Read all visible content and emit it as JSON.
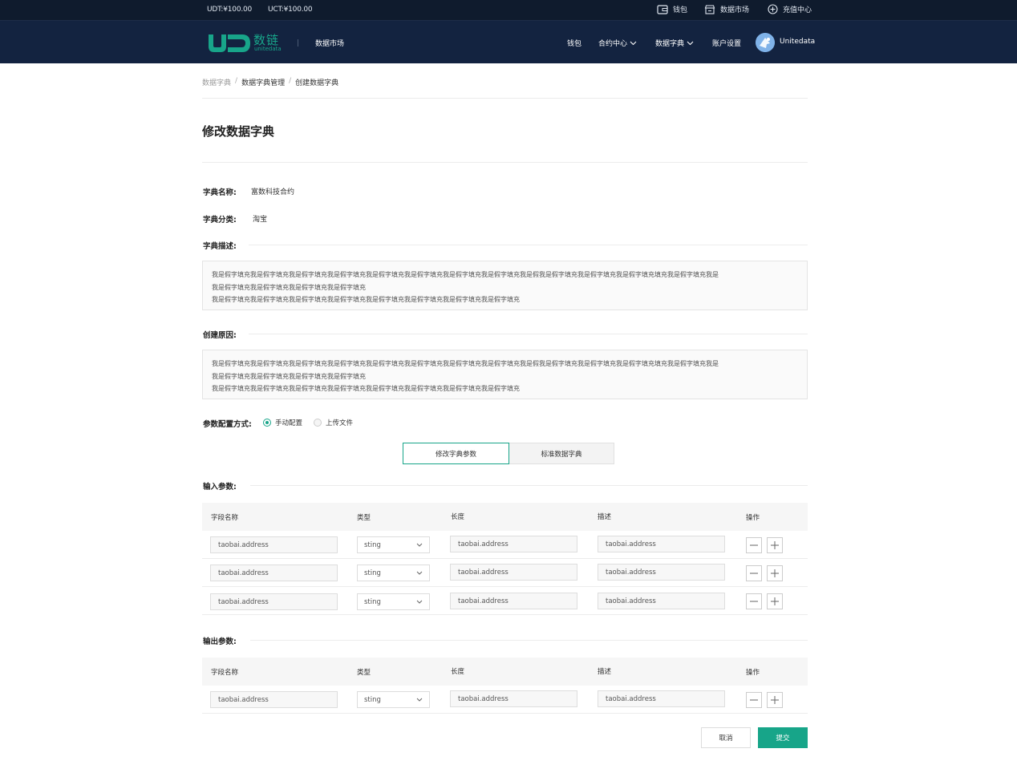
{
  "topbar": {
    "balance_udt": "UDT:¥100.00",
    "balance_uct": "UCT:¥100.00",
    "links": [
      {
        "label": "钱包",
        "icon": "wallet-icon"
      },
      {
        "label": "数据市场",
        "icon": "store-icon"
      },
      {
        "label": "充值中心",
        "icon": "recharge-icon"
      }
    ]
  },
  "header": {
    "logo_text": "数链",
    "logo_sub": "unitedata",
    "nav_market": "数据市场",
    "nav": [
      {
        "label": "钱包"
      },
      {
        "label": "合约中心"
      },
      {
        "label": "数据字典"
      },
      {
        "label": "账户设置"
      }
    ],
    "username": "Unitedata"
  },
  "breadcrumb": [
    "数据字典",
    "/",
    "数据字典管理",
    "/",
    "创建数据字典"
  ],
  "page_title": "修改数据字典",
  "form": {
    "name_label": "字典名称:",
    "name_value": "富数科技合约",
    "category_label": "字典分类:",
    "category_value": "淘宝",
    "desc_label": "字典描述:",
    "desc_lines": [
      "我是假字填充我是假字填充我是假字填充我是假字填充我是假字填充我是假字填充我是假字填充我是假字填充我是假我是假字填充我是假字填充我是假字填充填充我是假字填充我是",
      "我是假字填充我是假字填充我是假字填充我是假字填充",
      "我是假字填充我是假字填充我是假字填充我是假字填充我是假字填充我是假字填充我是假字填充我是假字填充"
    ],
    "reason_label": "创建原因:",
    "reason_lines": [
      "我是假字填充我是假字填充我是假字填充我是假字填充我是假字填充我是假字填充我是假字填充我是假字填充我是假我是假字填充我是假字填充我是假字填充填充我是假字填充我是",
      "我是假字填充我是假字填充我是假字填充我是假字填充",
      "我是假字填充我是假字填充我是假字填充我是假字填充我是假字填充我是假字填充我是假字填充我是假字填充"
    ],
    "config_label": "参数配置方式:",
    "config_options": [
      "手动配置",
      "上传文件"
    ],
    "config_selected": "手动配置"
  },
  "tabs": [
    "修改字典参数",
    "标准数据字典"
  ],
  "input_params": {
    "label": "输入参数:",
    "columns": [
      "字段名称",
      "类型",
      "长度",
      "描述",
      "操作"
    ],
    "rows": [
      {
        "name": "taobai.address",
        "type": "sting",
        "length": "taobai.address",
        "desc": "taobai.address"
      },
      {
        "name": "taobai.address",
        "type": "sting",
        "length": "taobai.address",
        "desc": "taobai.address"
      },
      {
        "name": "taobai.address",
        "type": "sting",
        "length": "taobai.address",
        "desc": "taobai.address"
      }
    ]
  },
  "output_params": {
    "label": "输出参数:",
    "columns": [
      "字段名称",
      "类型",
      "长度",
      "描述",
      "操作"
    ],
    "rows": [
      {
        "name": "taobai.address",
        "type": "sting",
        "length": "taobai.address",
        "desc": "taobai.address"
      }
    ]
  },
  "actions": {
    "cancel": "取消",
    "submit": "提交"
  },
  "colors": {
    "accent": "#17a589",
    "topbar": "#0f1b2d",
    "header": "#132340"
  }
}
